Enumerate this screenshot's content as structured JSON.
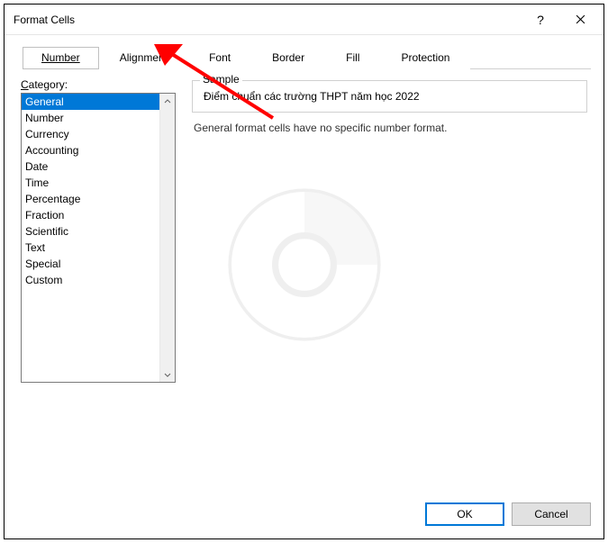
{
  "dialog": {
    "title": "Format Cells"
  },
  "tabs": {
    "number": "Number",
    "alignment": "Alignment",
    "font": "Font",
    "border": "Border",
    "fill": "Fill",
    "protection": "Protection"
  },
  "category": {
    "label_prefix": "C",
    "label_rest": "ategory:",
    "items": [
      "General",
      "Number",
      "Currency",
      "Accounting",
      "Date",
      "Time",
      "Percentage",
      "Fraction",
      "Scientific",
      "Text",
      "Special",
      "Custom"
    ],
    "selected": "General"
  },
  "sample": {
    "label": "Sample",
    "value": "Điểm chuẩn các trường THPT năm học 2022"
  },
  "description": "General format cells have no specific number format.",
  "buttons": {
    "ok": "OK",
    "cancel": "Cancel"
  },
  "colors": {
    "selection": "#0078d7",
    "annotation": "#ff0000"
  }
}
